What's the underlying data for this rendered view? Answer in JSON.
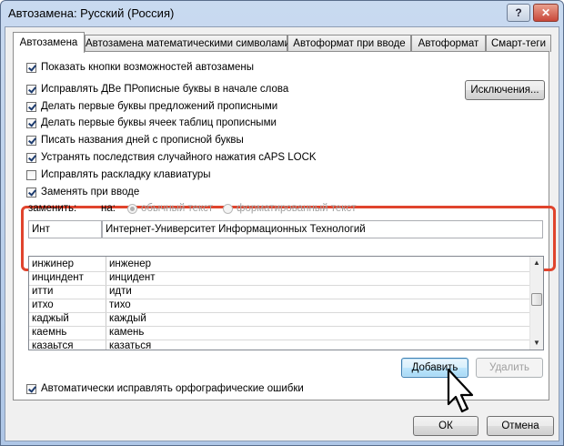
{
  "window": {
    "title": "Автозамена: Русский (Россия)",
    "help_label": "?",
    "close_label": "✕"
  },
  "tabs": [
    {
      "label": "Автозамена",
      "active": true
    },
    {
      "label": "Автозамена математическими символами",
      "active": false
    },
    {
      "label": "Автоформат при вводе",
      "active": false
    },
    {
      "label": "Автоформат",
      "active": false
    },
    {
      "label": "Смарт-теги",
      "active": false
    }
  ],
  "options": {
    "show_buttons": "Показать кнопки возможностей автозамены",
    "two_initials": "Исправлять ДВе ПРописные буквы в начале слова",
    "first_letter_sentences": "Делать первые буквы предложений прописными",
    "first_letter_cells": "Делать первые буквы ячеек таблиц прописными",
    "day_names": "Писать названия дней с прописной буквы",
    "caps_lock": "Устранять последствия случайного нажатия cAPS LOCK",
    "keyboard_layout": "Исправлять раскладку клавиатуры",
    "replace_as_you_type": "Заменять при вводе"
  },
  "exceptions_button": "Исключения...",
  "replace": {
    "replace_label": "заменить:",
    "with_label": "на:",
    "plain_text": "обычный текст",
    "formatted_text": "форматированный текст",
    "replace_value": "Инт",
    "with_value": "Интернет-Университет Информационных Технологий"
  },
  "list_rows": [
    {
      "from": "инжинер",
      "to": "инженер"
    },
    {
      "from": "инциндент",
      "to": "инцидент"
    },
    {
      "from": "итти",
      "to": "идти"
    },
    {
      "from": "итхо",
      "to": "тихо"
    },
    {
      "from": "каджый",
      "to": "каждый"
    },
    {
      "from": "каемнь",
      "to": "камень"
    },
    {
      "from": "казаьтся",
      "to": "казаться"
    }
  ],
  "add_button": "Добавить",
  "delete_button": "Удалить",
  "auto_spelling": "Автоматически исправлять орфографические ошибки",
  "ok_button": "ОК",
  "cancel_button": "Отмена",
  "scroll_up": "▲",
  "scroll_down": "▼"
}
